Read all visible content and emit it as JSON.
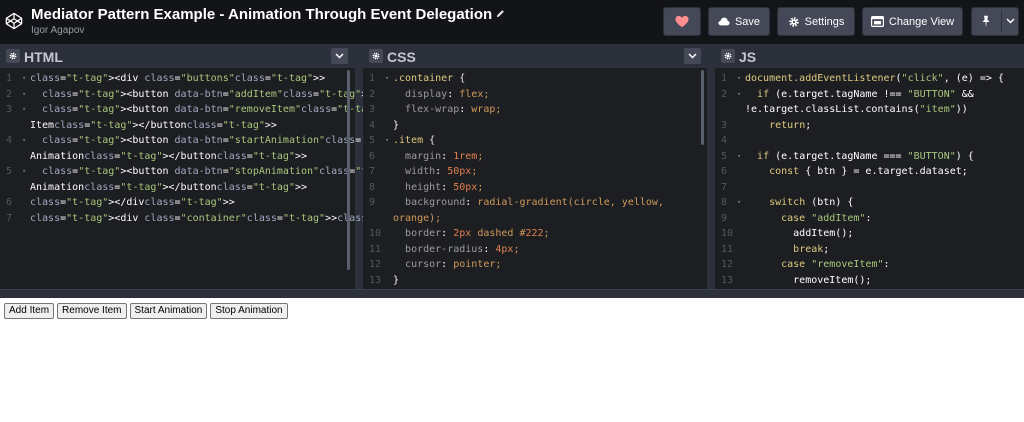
{
  "header": {
    "title": "Mediator Pattern Example - Animation Through Event Delegation",
    "author": "Igor Agapov",
    "save_label": "Save",
    "settings_label": "Settings",
    "change_view_label": "Change View",
    "heart_color": "#ff8f8f"
  },
  "editors": {
    "html": {
      "label": "HTML",
      "lines": [
        {
          "n": "1",
          "text": "<div class=\"buttons\">"
        },
        {
          "n": "2",
          "text": "  <button data-btn=\"addItem\">Add Item</button>"
        },
        {
          "n": "3",
          "text": "  <button data-btn=\"removeItem\">Remove"
        },
        {
          "n": "",
          "text": "Item</button>"
        },
        {
          "n": "4",
          "text": "  <button data-btn=\"startAnimation\">Start"
        },
        {
          "n": "",
          "text": "Animation</button>"
        },
        {
          "n": "5",
          "text": "  <button data-btn=\"stopAnimation\">Stop"
        },
        {
          "n": "",
          "text": "Animation</button>"
        },
        {
          "n": "6",
          "text": "</div>"
        },
        {
          "n": "7",
          "text": "<div class=\"container\"></div>"
        }
      ]
    },
    "css": {
      "label": "CSS",
      "lines": [
        {
          "n": "1",
          "text": ".container {"
        },
        {
          "n": "2",
          "text": "  display: flex;"
        },
        {
          "n": "3",
          "text": "  flex-wrap: wrap;"
        },
        {
          "n": "4",
          "text": "}"
        },
        {
          "n": "5",
          "text": ".item {"
        },
        {
          "n": "6",
          "text": "  margin: 1rem;"
        },
        {
          "n": "7",
          "text": "  width: 50px;"
        },
        {
          "n": "8",
          "text": "  height: 50px;"
        },
        {
          "n": "9",
          "text": "  background: radial-gradient(circle, yellow,"
        },
        {
          "n": "",
          "text": "orange);"
        },
        {
          "n": "10",
          "text": "  border: 2px dashed #222;"
        },
        {
          "n": "11",
          "text": "  border-radius: 4px;"
        },
        {
          "n": "12",
          "text": "  cursor: pointer;"
        },
        {
          "n": "13",
          "text": "}"
        }
      ]
    },
    "js": {
      "label": "JS",
      "lines": [
        {
          "n": "1",
          "text": "document.addEventListener(\"click\", (e) => {"
        },
        {
          "n": "2",
          "text": "  if (e.target.tagName !== \"BUTTON\" &&"
        },
        {
          "n": "",
          "text": "!e.target.classList.contains(\"item\"))"
        },
        {
          "n": "3",
          "text": "    return;"
        },
        {
          "n": "4",
          "text": ""
        },
        {
          "n": "5",
          "text": "  if (e.target.tagName === \"BUTTON\") {"
        },
        {
          "n": "6",
          "text": "    const { btn } = e.target.dataset;"
        },
        {
          "n": "7",
          "text": ""
        },
        {
          "n": "8",
          "text": "    switch (btn) {"
        },
        {
          "n": "9",
          "text": "      case \"addItem\":"
        },
        {
          "n": "10",
          "text": "        addItem();"
        },
        {
          "n": "11",
          "text": "        break;"
        },
        {
          "n": "12",
          "text": "      case \"removeItem\":"
        },
        {
          "n": "13",
          "text": "        removeItem();"
        }
      ]
    }
  },
  "result": {
    "buttons": [
      "Add Item",
      "Remove Item",
      "Start Animation",
      "Stop Animation"
    ]
  }
}
